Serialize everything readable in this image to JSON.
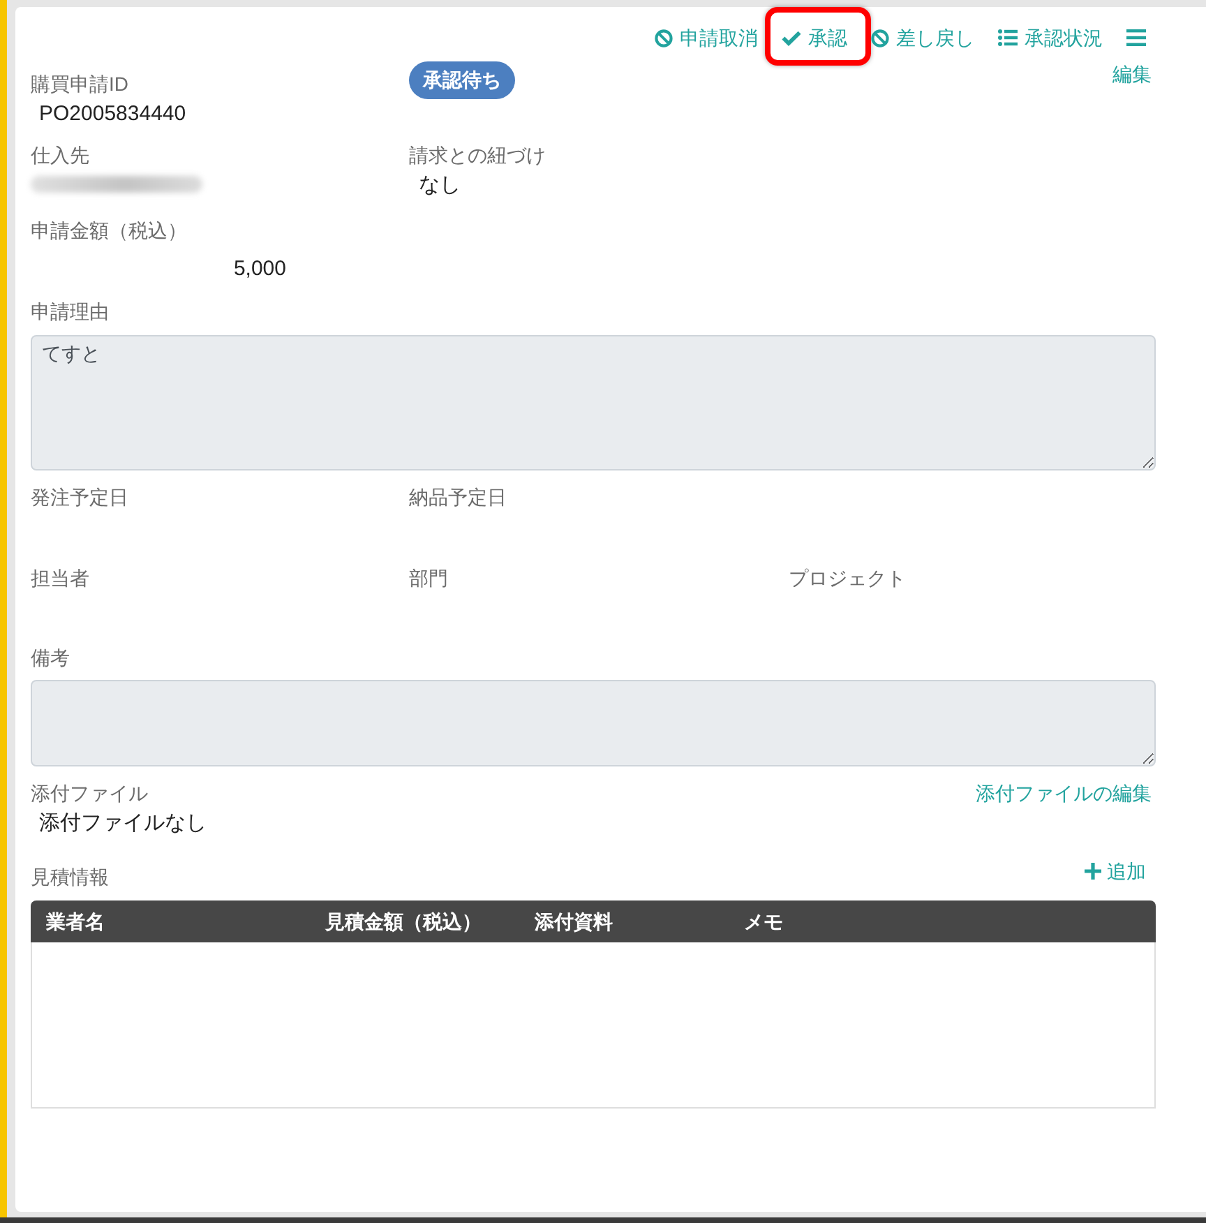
{
  "toolbar": [
    {
      "kind": "cancel",
      "label": "申請取消",
      "highlighted": false
    },
    {
      "kind": "approve",
      "label": "承認",
      "highlighted": true
    },
    {
      "kind": "return",
      "label": "差し戻し",
      "highlighted": false
    },
    {
      "kind": "status",
      "label": "承認状況",
      "highlighted": false
    },
    {
      "kind": "menu",
      "highlighted": false
    }
  ],
  "request_id": {
    "label": "購買申請ID",
    "value": "PO2005834440"
  },
  "status_badge": "承認待ち",
  "edit_link": "編集",
  "supplier": {
    "label": "仕入先",
    "value_blurred": true
  },
  "invoice_link": {
    "label": "請求との紐づけ",
    "value": "なし"
  },
  "amount": {
    "label": "申請金額（税込）",
    "value": "5,000"
  },
  "reason": {
    "label": "申請理由",
    "value": "てすと"
  },
  "date_row": [
    {
      "label": "発注予定日"
    },
    {
      "label": "納品予定日"
    }
  ],
  "owner_row": [
    {
      "label": "担当者"
    },
    {
      "label": "部門"
    },
    {
      "label": "プロジェクト"
    }
  ],
  "remarks": {
    "label": "備考"
  },
  "attachments": {
    "label": "添付ファイル",
    "edit_link": "添付ファイルの編集",
    "value": "添付ファイルなし"
  },
  "quotes": {
    "label": "見積情報",
    "add_button": "追加",
    "table": {
      "columns": [
        "業者名",
        "見積金額（税込）",
        "添付資料",
        "メモ"
      ]
    }
  }
}
